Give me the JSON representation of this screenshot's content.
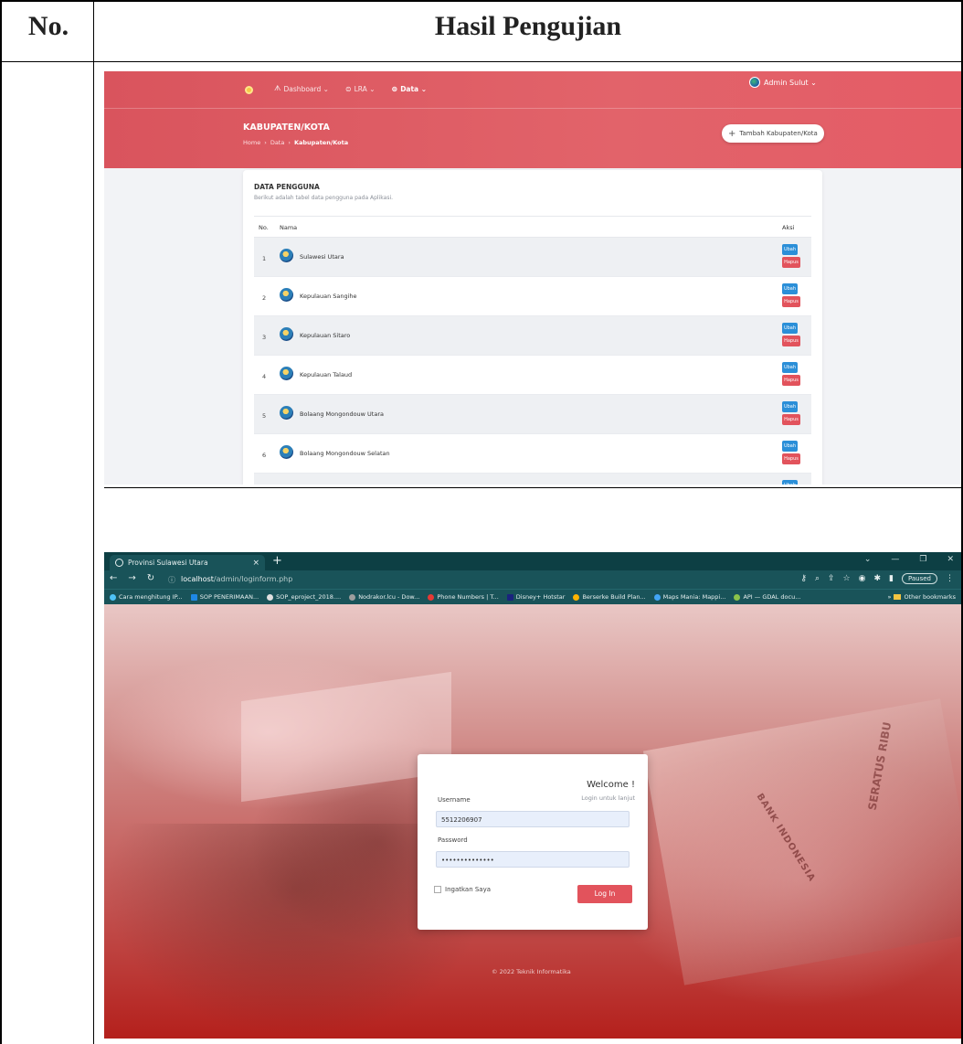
{
  "table_headers": {
    "no": "No.",
    "hasil": "Hasil Pengujian"
  },
  "admin": {
    "user": "Admin Sulut ⌄",
    "nav": [
      {
        "icon": "ᗑ",
        "label": "Dashboard ⌄"
      },
      {
        "icon": "⊜",
        "label": "LRA ⌄"
      },
      {
        "icon": "⊜",
        "label": "Data ⌄"
      }
    ],
    "page_title": "KABUPATEN/KOTA",
    "breadcrumb": {
      "home": "Home",
      "sep": "›",
      "data": "Data",
      "current": "Kabupaten/Kota"
    },
    "add_button": "Tambah Kabupaten/Kota",
    "card_title": "DATA PENGGUNA",
    "card_subtitle": "Berikut adalah tabel data pengguna pada Aplikasi.",
    "columns": {
      "no": "No.",
      "nama": "Nama",
      "aksi": "Aksi"
    },
    "rows": [
      {
        "no": "1",
        "name": "Sulawesi Utara"
      },
      {
        "no": "2",
        "name": "Kepulauan Sangihe"
      },
      {
        "no": "3",
        "name": "Kepulauan Sitaro"
      },
      {
        "no": "4",
        "name": "Kepulauan Talaud"
      },
      {
        "no": "5",
        "name": "Bolaang Mongondouw Utara"
      },
      {
        "no": "6",
        "name": "Bolaang Mongondouw Selatan"
      }
    ],
    "edit_label": "Ubah",
    "delete_label": "Hapus"
  },
  "browser": {
    "tab_title": "Provinsi Sulawesi Utara",
    "url_host": "localhost",
    "url_path": "/admin/loginform.php",
    "paused": "Paused",
    "bookmarks": [
      {
        "label": "Cara menghitung IP...",
        "color": "#4fc3f7"
      },
      {
        "label": "SOP PENERIMAAN...",
        "color": "#1e88e5"
      },
      {
        "label": "SOP_eproject_2018....",
        "color": "#e0e0e0"
      },
      {
        "label": "Nodrakor.lcu - Dow...",
        "color": "#9e9e9e"
      },
      {
        "label": "Phone Numbers | T...",
        "color": "#e53935"
      },
      {
        "label": "Disney+ Hotstar",
        "color": "#1a237e"
      },
      {
        "label": "Berserke Build Plan...",
        "color": "#ffb300"
      },
      {
        "label": "Maps Mania: Mappi...",
        "color": "#42a5f5"
      },
      {
        "label": "API — GDAL docu...",
        "color": "#8bc34a"
      }
    ],
    "more_bookmarks": "»",
    "other_bookmarks": "Other bookmarks"
  },
  "login": {
    "welcome": "Welcome !",
    "subtitle": "Login untuk lanjut",
    "username_label": "Username",
    "username_value": "5512206907",
    "password_label": "Password",
    "password_value": "••••••••••••••",
    "remember": "Ingatkan Saya",
    "login_button": "Log In",
    "footer": "© 2022 Teknik Informatika"
  },
  "colors": {
    "brand": "#e2535c",
    "edit": "#2b8fd8",
    "browser_chrome": "#195359"
  }
}
